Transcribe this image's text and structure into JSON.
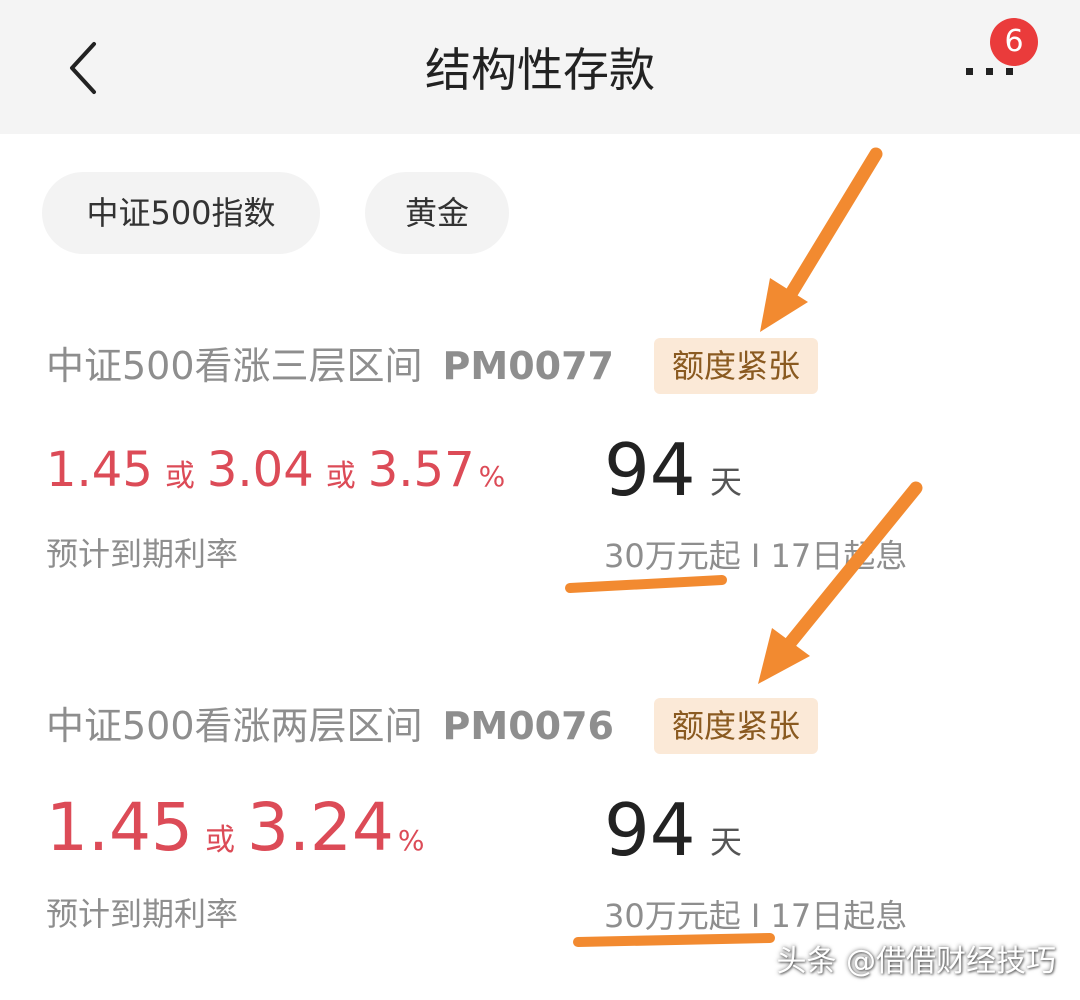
{
  "header": {
    "title": "结构性存款",
    "back_icon": "chevron-left-icon",
    "more_icon": "more-dots-icon",
    "badge_count": "6"
  },
  "filters": [
    {
      "label": "中证500指数"
    },
    {
      "label": "黄金"
    }
  ],
  "products": [
    {
      "name": "中证500看涨三层区间",
      "code": "PM0077",
      "tag": "额度紧张",
      "rates": [
        "1.45",
        "3.04",
        "3.57"
      ],
      "rate_separator": "或",
      "rate_unit": "%",
      "rate_label": "预计到期利率",
      "days": "94",
      "days_unit": "天",
      "minimum": "30万元起 I 17日起息"
    },
    {
      "name": "中证500看涨两层区间",
      "code": "PM0076",
      "tag": "额度紧张",
      "rates": [
        "1.45",
        "3.24"
      ],
      "rate_separator": "或",
      "rate_unit": "%",
      "rate_label": "预计到期利率",
      "days": "94",
      "days_unit": "天",
      "minimum": "30万元起 I 17日起息"
    }
  ],
  "watermark": "头条 @借借财经技巧",
  "colors": {
    "rate": "#dc4b57",
    "annotation": "#f28a30",
    "badge": "#ea3b3b",
    "tag_bg": "#fbe9d7",
    "tag_text": "#8a5a20"
  }
}
